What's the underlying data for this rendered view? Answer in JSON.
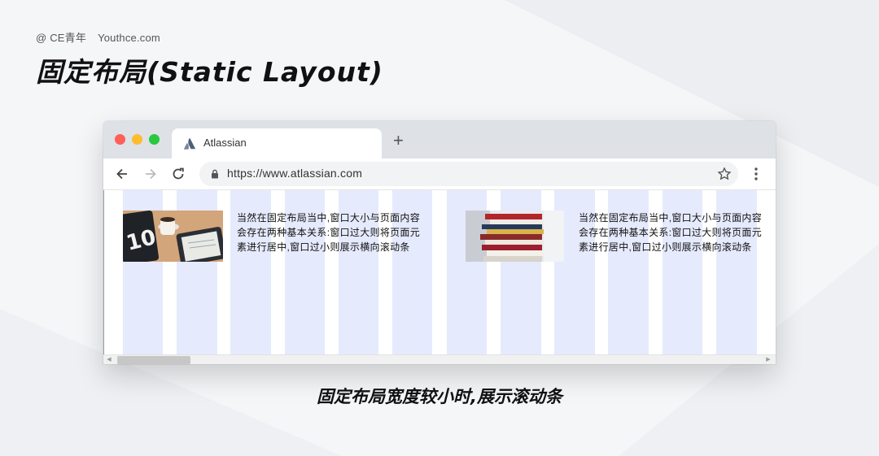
{
  "credit": {
    "author": "@ CE青年",
    "site": "Youthce.com"
  },
  "title": "固定布局(Static Layout)",
  "caption": "固定布局宽度较小时,展示滚动条",
  "browser": {
    "tab_title": "Atlassian",
    "url": "https://www.atlassian.com",
    "new_tab_label": "+"
  },
  "cards": [
    {
      "lines": [
        "当然在固定布局当中,窗口大小与页面内容",
        "会存在两种基本关系:窗口过大则将页面元",
        "素进行居中,窗口过小则展示横向滚动条"
      ]
    },
    {
      "lines": [
        "当然在固定布局当中,窗口大小与页面内容",
        "会存在两种基本关系:窗口过大则将页面元",
        "素进行居中,窗口过小则展示横向滚动条"
      ]
    }
  ],
  "colors": {
    "grid_column": "#e6eafd",
    "tab_bar": "#dee1e6",
    "traffic_red": "#fe5f57",
    "traffic_yellow": "#febc2e",
    "traffic_green": "#28c840"
  },
  "icons": [
    "back-arrow-icon",
    "forward-arrow-icon",
    "reload-icon",
    "lock-icon",
    "star-icon",
    "kebab-menu-icon",
    "atlassian-logo-icon"
  ]
}
